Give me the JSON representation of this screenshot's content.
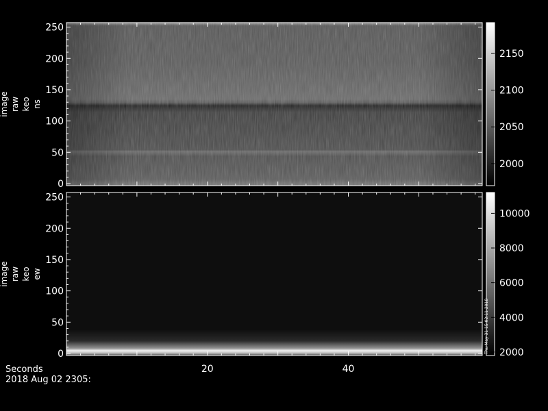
{
  "chart_data": [
    {
      "type": "heatmap",
      "ylabel": [
        "image",
        "raw",
        "keo",
        "ns"
      ],
      "ylim": [
        0,
        255
      ],
      "yticks": [
        0,
        50,
        100,
        150,
        200,
        250
      ],
      "colorbar": {
        "ticks": [
          2000,
          2050,
          2100,
          2150
        ],
        "range": [
          1970,
          2192
        ]
      },
      "features": [
        {
          "y": 129,
          "description": "dark band"
        },
        {
          "y": 55,
          "description": "bright line"
        }
      ]
    },
    {
      "type": "heatmap",
      "ylabel": [
        "image",
        "raw",
        "keo",
        "ew"
      ],
      "ylim": [
        0,
        255
      ],
      "yticks": [
        0,
        50,
        100,
        150,
        200,
        250
      ],
      "colorbar": {
        "ticks": [
          2000,
          4000,
          6000,
          8000,
          10000
        ],
        "range": [
          1800,
          11200
        ],
        "annotation": "Thu May 31 15:02:11 2018"
      },
      "features": [
        {
          "y": 8,
          "description": "bright band"
        }
      ]
    }
  ],
  "x_axis": {
    "label": "Seconds",
    "date": "2018 Aug 02 2305:",
    "ticks": [
      20,
      40
    ],
    "xlim": [
      0,
      59
    ]
  }
}
